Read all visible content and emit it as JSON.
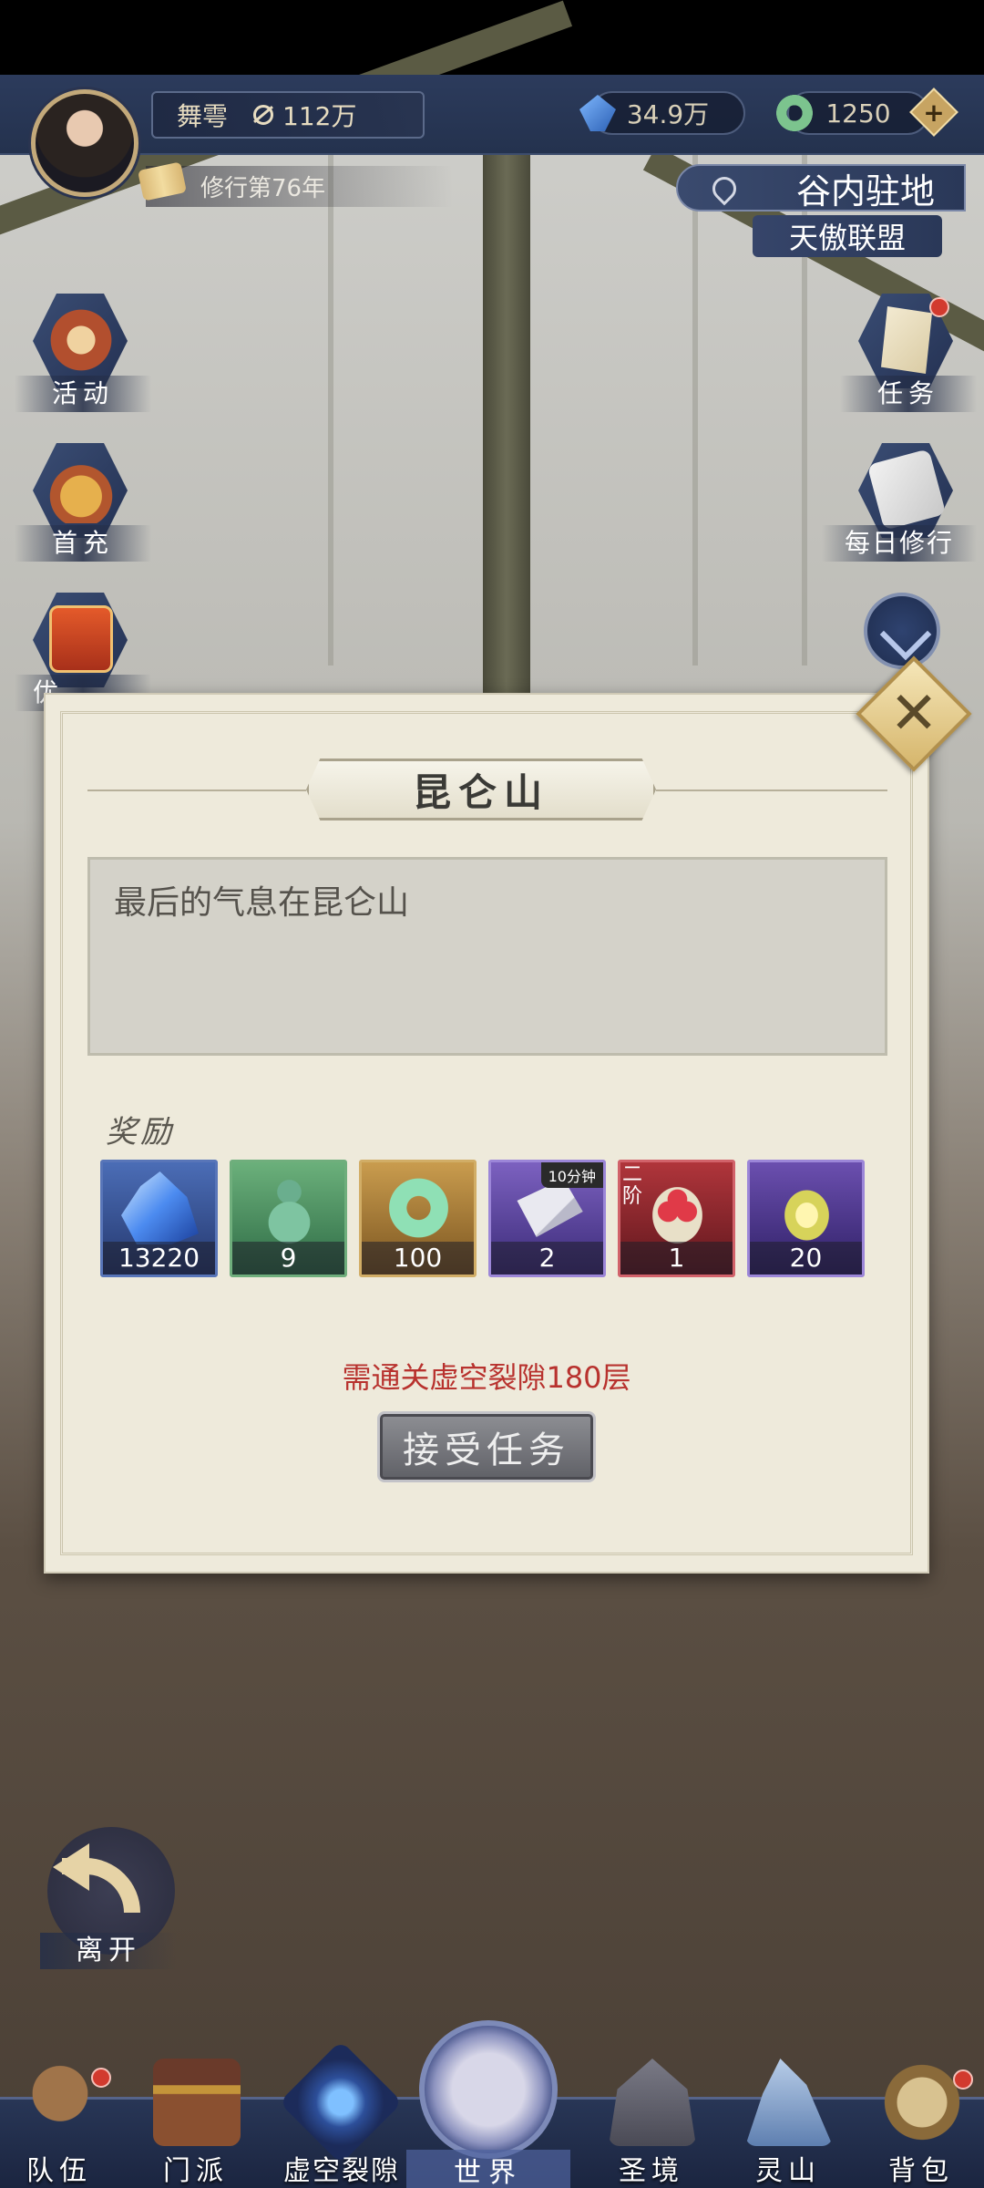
{
  "header": {
    "player_name": "舞雩",
    "power": "112万",
    "crystals": "34.9万",
    "jade": "1250",
    "plus_label": "+",
    "cultivation": "修行第76年",
    "location": "谷内驻地",
    "guild": "天傲联盟"
  },
  "left_menu": [
    {
      "label": "活动"
    },
    {
      "label": "首充"
    },
    {
      "label": "优"
    }
  ],
  "right_menu": [
    {
      "label": "任务"
    },
    {
      "label": "每日修行"
    }
  ],
  "modal": {
    "title": "昆仑山",
    "description": "最后的气息在昆仑山",
    "reward_heading": "奖励",
    "rewards": [
      {
        "icon": "crystal-icon",
        "count": "13220"
      },
      {
        "icon": "gourd-icon",
        "count": "9"
      },
      {
        "icon": "jade-icon",
        "count": "100"
      },
      {
        "icon": "scroll-icon",
        "count": "2",
        "badge": "10分钟"
      },
      {
        "icon": "fruit-icon",
        "count": "1",
        "badge": "二阶"
      },
      {
        "icon": "flame-icon",
        "count": "20"
      }
    ],
    "requirement": "需通关虚空裂隙180层",
    "accept_label": "接受任务",
    "close_label": "✕"
  },
  "leave_label": "离开",
  "bottom_nav": [
    {
      "label": "队伍"
    },
    {
      "label": "门派"
    },
    {
      "label": "虚空裂隙"
    },
    {
      "label": "世界"
    },
    {
      "label": "圣境"
    },
    {
      "label": "灵山"
    },
    {
      "label": "背包"
    }
  ]
}
